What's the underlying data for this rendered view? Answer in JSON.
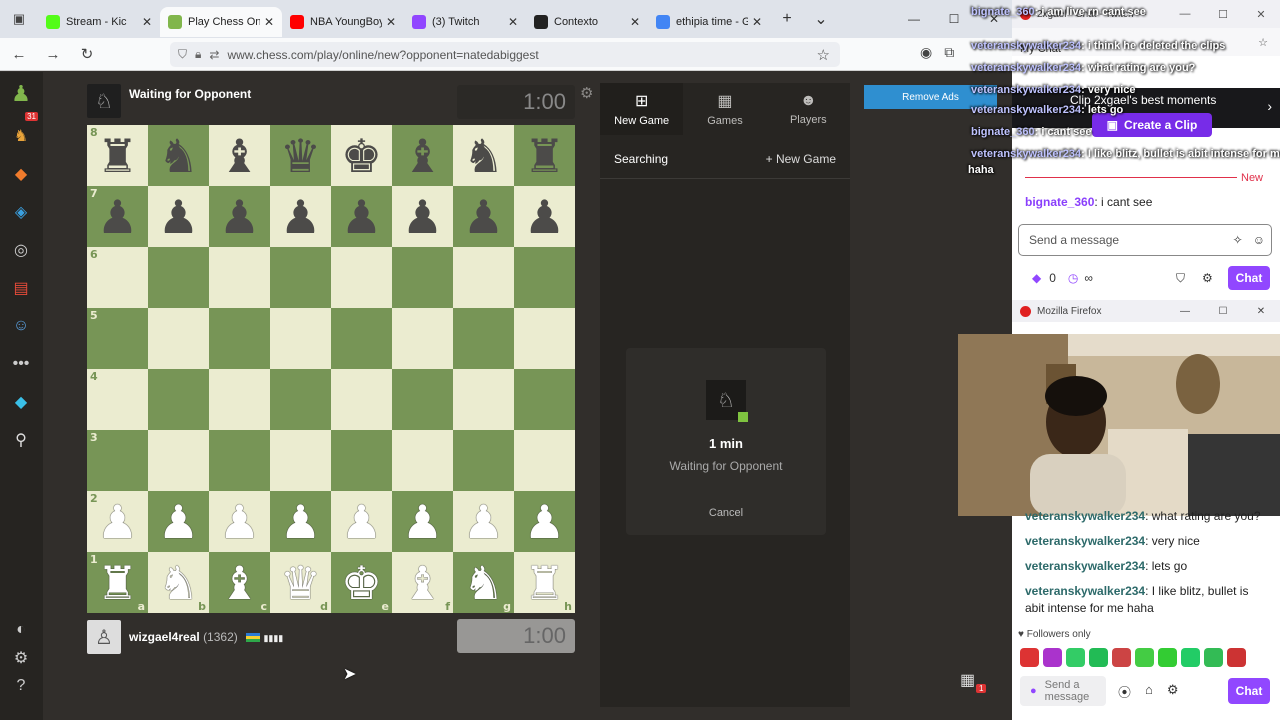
{
  "browser": {
    "tabs": [
      {
        "title": "Stream - Kic",
        "color": "#53fc18"
      },
      {
        "title": "Play Chess Onlin",
        "color": "#81b64c",
        "active": true
      },
      {
        "title": "NBA YoungBoy",
        "color": "#ff0000"
      },
      {
        "title": "(3) Twitch",
        "color": "#9146ff"
      },
      {
        "title": "Contexto",
        "color": "#222222"
      },
      {
        "title": "ethipia time - Go",
        "color": "#4285f4"
      }
    ],
    "url": "www.chess.com/play/online/new?opponent=natedabiggest"
  },
  "sidebar": {
    "badge": "31"
  },
  "game": {
    "top_player": {
      "name": "Waiting for Opponent"
    },
    "top_clock": "1:00",
    "bottom_player": {
      "name": "wizgael4real",
      "rating": "(1362)",
      "bars": "▮▮▮▮"
    },
    "bottom_clock": "1:00"
  },
  "board": {
    "ranks": [
      "8",
      "7",
      "6",
      "5",
      "4",
      "3",
      "2",
      "1"
    ],
    "files": [
      "a",
      "b",
      "c",
      "d",
      "e",
      "f",
      "g",
      "h"
    ],
    "rows": [
      [
        "r",
        "n",
        "b",
        "q",
        "k",
        "b",
        "n",
        "r"
      ],
      [
        "p",
        "p",
        "p",
        "p",
        "p",
        "p",
        "p",
        "p"
      ],
      [
        "",
        "",
        "",
        "",
        "",
        "",
        "",
        ""
      ],
      [
        "",
        "",
        "",
        "",
        "",
        "",
        "",
        ""
      ],
      [
        "",
        "",
        "",
        "",
        "",
        "",
        "",
        ""
      ],
      [
        "",
        "",
        "",
        "",
        "",
        "",
        "",
        ""
      ],
      [
        "P",
        "P",
        "P",
        "P",
        "P",
        "P",
        "P",
        "P"
      ],
      [
        "R",
        "N",
        "B",
        "Q",
        "K",
        "B",
        "N",
        "R"
      ]
    ]
  },
  "panel": {
    "tabs": [
      {
        "label": "New Game",
        "icon": "plus-square-icon",
        "active": true
      },
      {
        "label": "Games",
        "icon": "checker-icon"
      },
      {
        "label": "Players",
        "icon": "players-icon"
      }
    ],
    "searching": "Searching",
    "new_game_link": "New Game",
    "card": {
      "time": "1 min",
      "status": "Waiting for Opponent",
      "cancel": "Cancel"
    }
  },
  "ads": {
    "remove": "Remove Ads"
  },
  "bottom_badge": "1",
  "twitch": {
    "window_title": "2xgael - Chat - Twitch —",
    "my_chat": "My Chat",
    "clip_banner": "Clip 2xgael's best moments",
    "create_clip": "Create a Clip",
    "overlay": [
      {
        "user": "bignate_360",
        "text": ": i am live rn cant see"
      },
      {
        "user": "veteranskywalker234",
        "text": ": i think he deleted the clips"
      },
      {
        "user": "veteranskywalker234",
        "text": ": what rating are you?"
      },
      {
        "user": "veteranskywalker234",
        "text": ": very nice"
      },
      {
        "user": "veteranskywalker234",
        "text": ": lets go"
      },
      {
        "user": "bignate_360",
        "text": ": i cant see"
      },
      {
        "user": "veteranskywalker234",
        "text": ": I like blitz, bullet is abit intense for me"
      }
    ],
    "overlay_tail": "haha",
    "new_label": "New",
    "last_msg": {
      "user": "bignate_360",
      "text": ": i cant see",
      "color": "#8a3ffc"
    },
    "send_placeholder": "Send a message",
    "points": "0",
    "infinity": "∞",
    "chat_button": "Chat"
  },
  "firefox": {
    "window_title": "Mozilla Firefox",
    "messages": [
      {
        "user": "veteranskywalker234",
        "text": ": what rating are you?"
      },
      {
        "user": "veteranskywalker234",
        "text": ": very nice"
      },
      {
        "user": "veteranskywalker234",
        "text": ": lets go"
      },
      {
        "user": "veteranskywalker234",
        "text": ": I like blitz, bullet is abit intense for me haha"
      }
    ],
    "followers_only": "♥ Followers only",
    "send_placeholder": "Send a message",
    "chat_button": "Chat",
    "emote_colors": [
      "#d33",
      "#a3c",
      "#3c6",
      "#2b5",
      "#c44",
      "#4c4",
      "#3c3",
      "#2c6",
      "#3b5",
      "#c33"
    ]
  }
}
